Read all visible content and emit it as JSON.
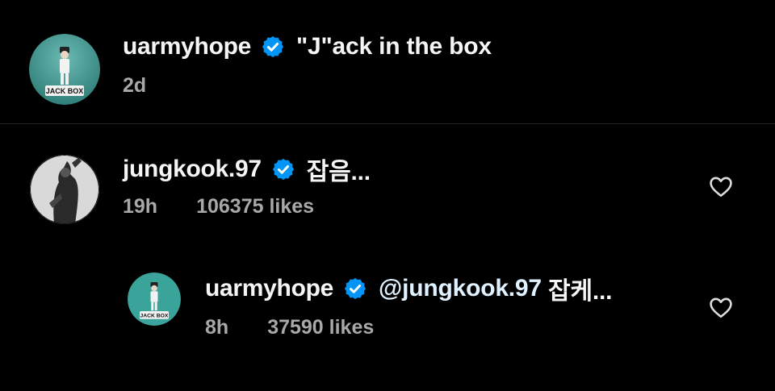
{
  "caption": {
    "username": "uarmyhope",
    "text": "\"J\"ack in the box",
    "time": "2d",
    "avatar_text": "JACK IN THE BOX"
  },
  "comment": {
    "username": "jungkook.97",
    "text": "잡음...",
    "time": "19h",
    "likes": "106375 likes"
  },
  "reply": {
    "username": "uarmyhope",
    "mention": "@jungkook.97",
    "text": " 잡케...",
    "time": "8h",
    "likes": "37590 likes",
    "avatar_text": "JACK IN THE BOX"
  },
  "colors": {
    "background": "#000000",
    "verified": "#0095f6",
    "muted": "#a8a8a8",
    "avatar_teal": "#3aa39a"
  },
  "icons": {
    "verified": "verified-badge-icon",
    "like": "heart-icon"
  }
}
